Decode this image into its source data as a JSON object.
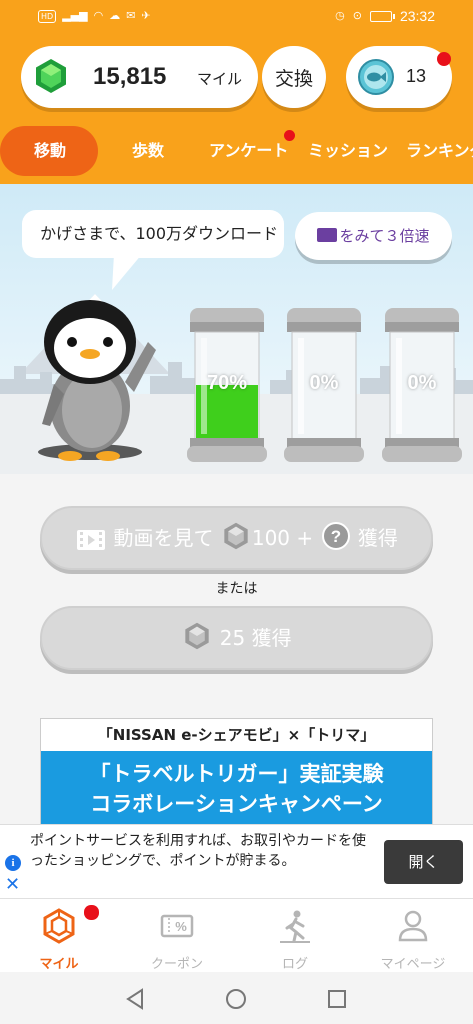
{
  "status_bar": {
    "time": "23:32",
    "hd_badge": "HD"
  },
  "header": {
    "miles_value": "15,815",
    "miles_unit": "マイル",
    "exchange_label": "交換",
    "fish_count": "13"
  },
  "tabs": [
    {
      "label": "移動",
      "active": true
    },
    {
      "label": "歩数",
      "active": false
    },
    {
      "label": "アンケート",
      "active": false,
      "badge": true
    },
    {
      "label": "ミッション",
      "active": false
    },
    {
      "label": "ランキング",
      "active": false
    }
  ],
  "bubble_text": "かげさまで、100万ダウンロード",
  "watch_button": "をみて３倍速",
  "jars": [
    {
      "label": "70%",
      "fill": 0.7
    },
    {
      "label": "0%",
      "fill": 0
    },
    {
      "label": "0%",
      "fill": 0
    }
  ],
  "video_button": {
    "prefix": "動画を見て",
    "amount": "100 +",
    "suffix": "獲得"
  },
  "or_text": "または",
  "earn_button": {
    "amount": "25",
    "suffix": "獲得"
  },
  "banner": {
    "top": "「NISSAN e-シェアモビ」×「トリマ」",
    "line1": "「トラベルトリガー」実証実験",
    "line2": "コラボレーションキャンペーン"
  },
  "ad": {
    "text": "ポイントサービスを利用すれば、お取引やカードを使ったショッピングで、ポイントが貯まる。",
    "open_label": "開く"
  },
  "bottom_nav": [
    {
      "label": "マイル",
      "icon": "miles-gem-icon",
      "active": true
    },
    {
      "label": "クーポン",
      "icon": "coupon-icon",
      "active": false
    },
    {
      "label": "ログ",
      "icon": "log-walker-icon",
      "active": false
    },
    {
      "label": "マイページ",
      "icon": "user-icon",
      "active": false
    }
  ],
  "colors": {
    "header_orange": "#f9a21b",
    "active_tab": "#ee6416",
    "notification_red": "#e8101a",
    "jar_fill_green": "#3fcf1c",
    "banner_blue": "#1a9be0"
  }
}
